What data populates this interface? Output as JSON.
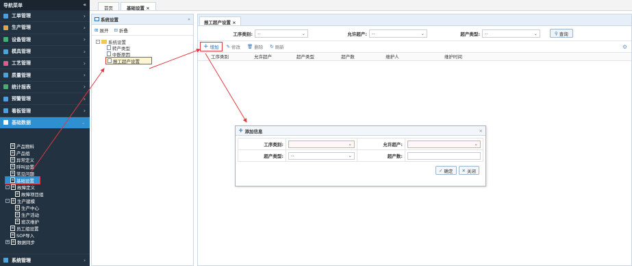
{
  "sidebar": {
    "title": "导航菜单",
    "collapse": "«",
    "items": [
      {
        "label": "工单管理",
        "color": "#4aa3df"
      },
      {
        "label": "生产管理",
        "color": "#e8a13c"
      },
      {
        "label": "设备管理",
        "color": "#3cb371"
      },
      {
        "label": "模具管理",
        "color": "#4aa3df"
      },
      {
        "label": "工艺管理",
        "color": "#e05a8a"
      },
      {
        "label": "质量管理",
        "color": "#4aa3df"
      },
      {
        "label": "统计报表",
        "color": "#3cb371"
      },
      {
        "label": "预警管理",
        "color": "#4aa3df"
      },
      {
        "label": "看板管理",
        "color": "#4aa3df"
      },
      {
        "label": "基础数据",
        "color": "#ffffff"
      }
    ],
    "tree": [
      {
        "label": "产品物料",
        "indent": 1
      },
      {
        "label": "产品组",
        "indent": 1
      },
      {
        "label": "异常定义",
        "indent": 1
      },
      {
        "label": "呼叫设置",
        "indent": 1
      },
      {
        "label": "常见问题",
        "indent": 1
      },
      {
        "label": "基础设置",
        "indent": 1,
        "highlight": true
      },
      {
        "label": "故障定义",
        "indent": 0,
        "toggle": "-"
      },
      {
        "label": "故障项目组",
        "indent": 2
      },
      {
        "label": "生产建模",
        "indent": 0,
        "toggle": "-"
      },
      {
        "label": "生产中心",
        "indent": 2
      },
      {
        "label": "生产活动",
        "indent": 2
      },
      {
        "label": "班次维护",
        "indent": 2
      },
      {
        "label": "员工组设置",
        "indent": 1
      },
      {
        "label": "SOP导入",
        "indent": 1
      },
      {
        "label": "数据同步",
        "indent": 0,
        "toggle": "+"
      }
    ],
    "bottom": "系统管理"
  },
  "tabs": [
    {
      "label": "首页"
    },
    {
      "label": "基础设置 ×"
    }
  ],
  "left_panel": {
    "title": "系统设置",
    "collapse": "«",
    "expand": "展开",
    "fold": "折叠",
    "tree": [
      {
        "label": "系统设置",
        "type": "folder"
      },
      {
        "label": "转产类型",
        "type": "doc"
      },
      {
        "label": "中断原因",
        "type": "doc"
      },
      {
        "label": "报工超产设置",
        "type": "doc",
        "highlight": true
      }
    ]
  },
  "main": {
    "tab": "报工超产设置 ×",
    "search": {
      "process_label": "工序类别:",
      "process_value": "--",
      "allow_label": "允许超产:",
      "allow_value": "--",
      "type_label": "超产类型:",
      "type_value": "--",
      "query": "查询"
    },
    "toolbar": {
      "add": "增加",
      "edit": "修改",
      "delete": "删除",
      "refresh": "刷新"
    },
    "columns": [
      "工序类别",
      "允许超产",
      "超产类型",
      "超产数",
      "维护人",
      "维护时间"
    ]
  },
  "dialog": {
    "title": "添加信息",
    "close": "×",
    "process_label": "工序类别:",
    "allow_label": "允许超产:",
    "type_label": "超产类型:",
    "type_value": "--",
    "count_label": "超产数:",
    "ok": "确定",
    "cancel": "关闭"
  },
  "colors": {
    "sidebar_bg": "#233240",
    "active": "#2e8fd1",
    "annotation": "#e0393e"
  }
}
